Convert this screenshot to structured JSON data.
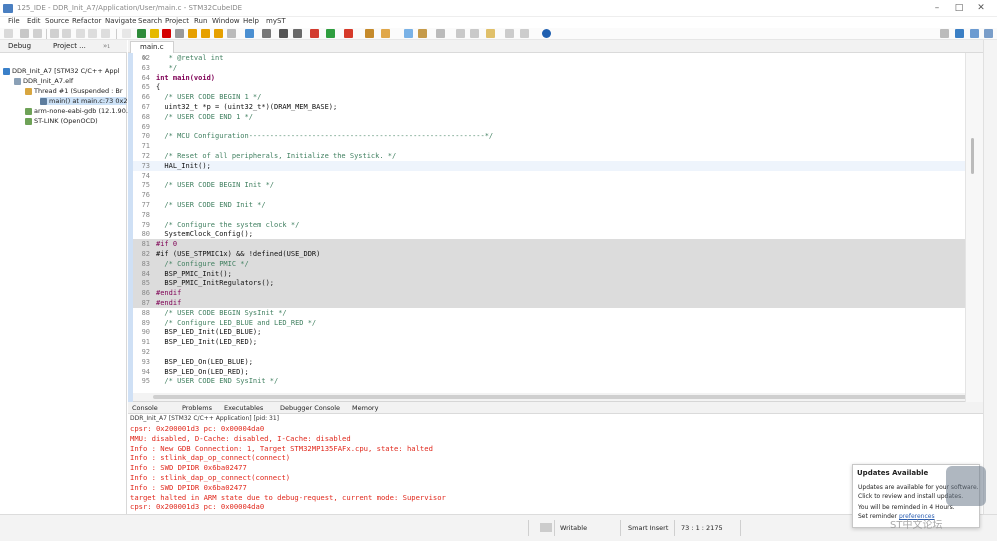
{
  "window": {
    "title": "125_IDE - DDR_Init_A7/Application/User/main.c - STM32CubeIDE"
  },
  "menu": [
    "File",
    "Edit",
    "Source",
    "Refactor",
    "Navigate",
    "Search",
    "Project",
    "Run",
    "Window",
    "Help",
    "myST"
  ],
  "left_panel": {
    "tabs": [
      "Debug",
      "Project ..."
    ],
    "tree": [
      "DDR_Init_A7 [STM32 C/C++ Appl",
      "DDR_Init_A7.elf",
      "Thread #1 (Suspended : Br",
      "main() at main.c:73 0x28",
      "arm-none-eabi-gdb (12.1.90.2",
      "ST-LINK (OpenOCD)"
    ]
  },
  "editor": {
    "tab_label": "main.c",
    "lines": [
      {
        "n": "62",
        "t": "   * @retval int",
        "cls": "cm"
      },
      {
        "n": "63",
        "t": "   */",
        "cls": "cm"
      },
      {
        "n": "64",
        "t": "int main(void)",
        "cls": "kwline"
      },
      {
        "n": "65",
        "t": "{",
        "cls": ""
      },
      {
        "n": "66",
        "t": "  /* USER CODE BEGIN 1 */",
        "cls": "cm"
      },
      {
        "n": "67",
        "t": "  uint32_t *p = (uint32_t*)(DRAM_MEM_BASE);",
        "cls": ""
      },
      {
        "n": "68",
        "t": "  /* USER CODE END 1 */",
        "cls": "cm"
      },
      {
        "n": "69",
        "t": "",
        "cls": ""
      },
      {
        "n": "70",
        "t": "  /* MCU Configuration--------------------------------------------------------*/",
        "cls": "cm"
      },
      {
        "n": "71",
        "t": "",
        "cls": ""
      },
      {
        "n": "72",
        "t": "  /* Reset of all peripherals, Initialize the Systick. */",
        "cls": "cm"
      },
      {
        "n": "73",
        "t": "  HAL_Init();",
        "cls": "cur"
      },
      {
        "n": "74",
        "t": "",
        "cls": ""
      },
      {
        "n": "75",
        "t": "  /* USER CODE BEGIN Init */",
        "cls": "cm"
      },
      {
        "n": "76",
        "t": "",
        "cls": ""
      },
      {
        "n": "77",
        "t": "  /* USER CODE END Init */",
        "cls": "cm"
      },
      {
        "n": "78",
        "t": "",
        "cls": ""
      },
      {
        "n": "79",
        "t": "  /* Configure the system clock */",
        "cls": "cm"
      },
      {
        "n": "80",
        "t": "  SystemClock_Config();",
        "cls": ""
      },
      {
        "n": "81",
        "t": "#if 0",
        "cls": "grey pp"
      },
      {
        "n": "82",
        "t": "#if (USE_STPMIC1x) && !defined(USE_DDR)",
        "cls": "grey"
      },
      {
        "n": "83",
        "t": "  /* Configure PMIC */",
        "cls": "grey cm"
      },
      {
        "n": "84",
        "t": "  BSP_PMIC_Init();",
        "cls": "grey"
      },
      {
        "n": "85",
        "t": "  BSP_PMIC_InitRegulators();",
        "cls": "grey"
      },
      {
        "n": "86",
        "t": "#endif",
        "cls": "grey pp"
      },
      {
        "n": "87",
        "t": "#endif",
        "cls": "grey pp"
      },
      {
        "n": "88",
        "t": "  /* USER CODE BEGIN SysInit */",
        "cls": "cm"
      },
      {
        "n": "89",
        "t": "  /* Configure LED_BLUE and LED_RED */",
        "cls": "cm"
      },
      {
        "n": "90",
        "t": "  BSP_LED_Init(LED_BLUE);",
        "cls": ""
      },
      {
        "n": "91",
        "t": "  BSP_LED_Init(LED_RED);",
        "cls": ""
      },
      {
        "n": "92",
        "t": "",
        "cls": ""
      },
      {
        "n": "93",
        "t": "  BSP_LED_On(LED_BLUE);",
        "cls": ""
      },
      {
        "n": "94",
        "t": "  BSP_LED_On(LED_RED);",
        "cls": ""
      },
      {
        "n": "95",
        "t": "  /* USER CODE END SysInit */",
        "cls": "cm"
      }
    ]
  },
  "console": {
    "tabs": [
      "Console",
      "Problems",
      "Executables",
      "Debugger Console",
      "Memory"
    ],
    "description": "DDR_Init_A7 [STM32 C/C++ Application] [pid: 31]",
    "lines": [
      "cpsr: 0x200001d3 pc: 0x00004da0",
      "MMU: disabled, D-Cache: disabled, I-Cache: disabled",
      "Info : New GDB Connection: 1, Target STM32MP135FAFx.cpu, state: halted",
      "Info : stlink_dap_op_connect(connect)",
      "Info : SWD DPIDR 0x6ba02477",
      "Info : stlink_dap_op_connect(connect)",
      "Info : SWD DPIDR 0x6ba02477",
      "target halted in ARM state due to debug-request, current mode: Supervisor",
      "cpsr: 0x200001d3 pc: 0x00004da0"
    ]
  },
  "status": {
    "writable": "Writable",
    "insert_mode": "Smart Insert",
    "position": "73 : 1 : 2175"
  },
  "notification": {
    "title": "Updates Available",
    "line1": "Updates are available for your software.",
    "line2": "Click to review and install updates.",
    "line3": "You will be reminded in 4 Hours.",
    "line4_prefix": "Set reminder",
    "line4_link": "preferences"
  },
  "watermark": "ST中文论坛",
  "colors": {
    "console_text": "#e0281c",
    "current_line": "#eef4fc",
    "disabled_block": "#dcdcdc",
    "comment": "#3f7f5f",
    "keyword": "#7f0055"
  }
}
